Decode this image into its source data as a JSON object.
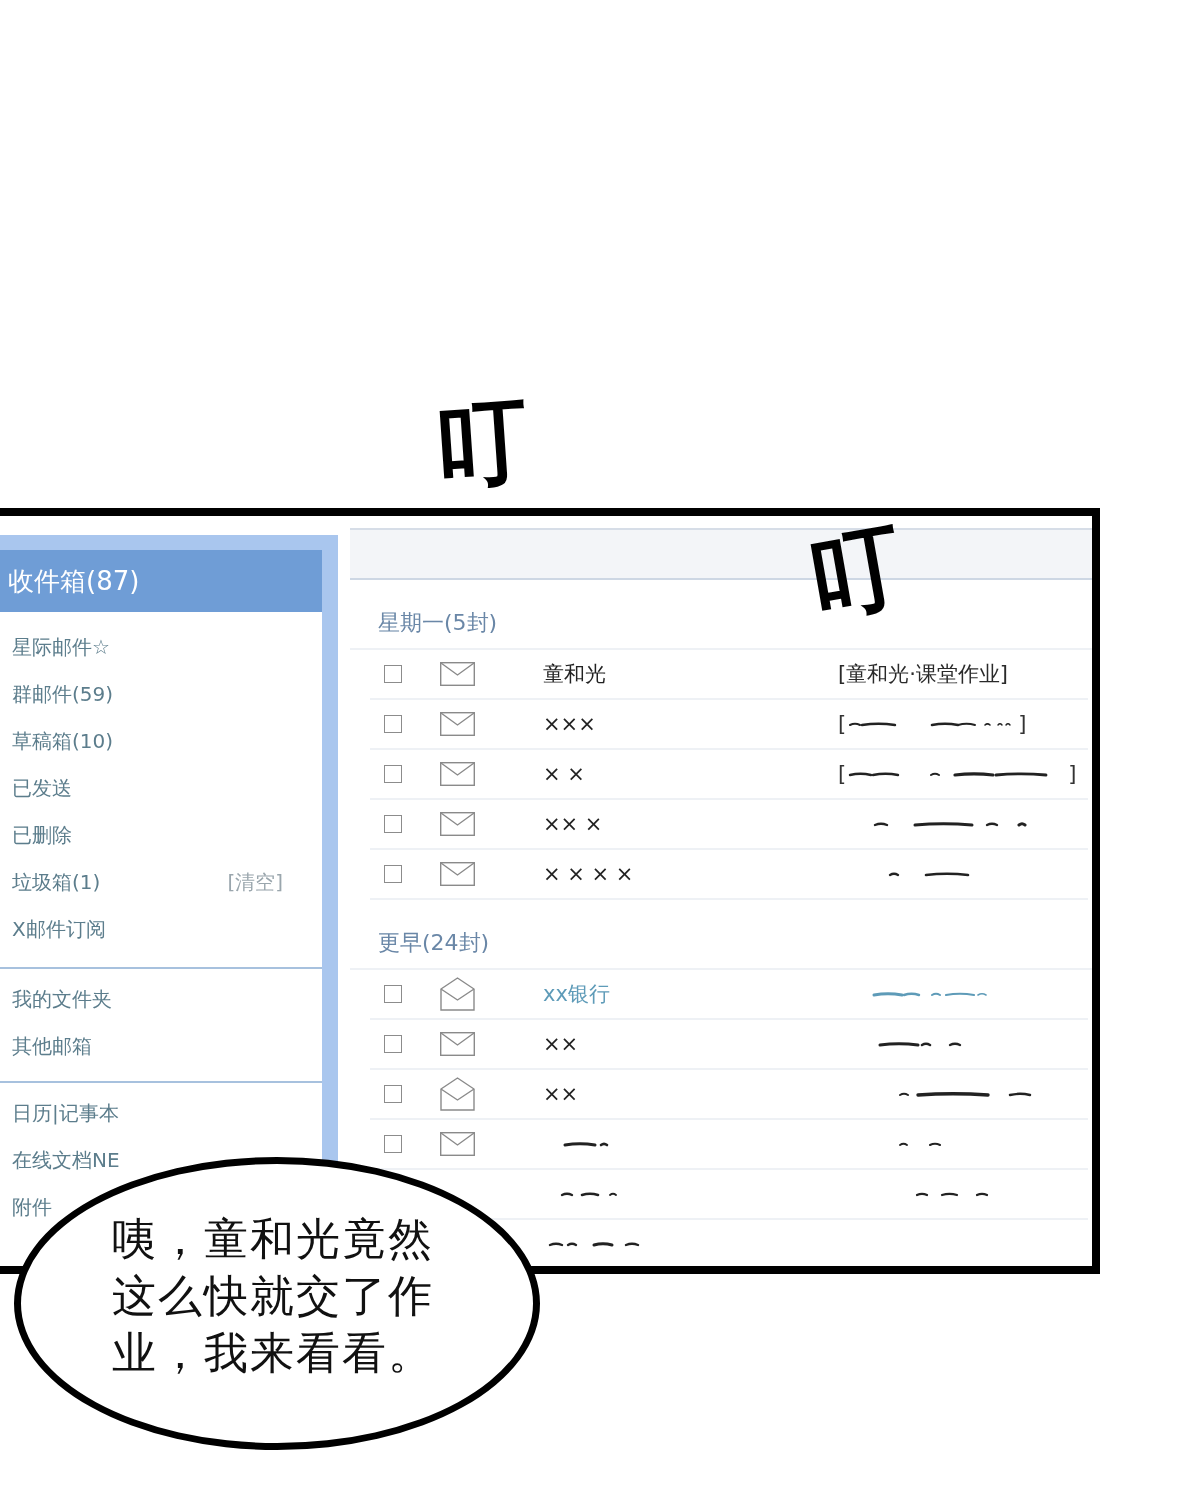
{
  "sound_effects": [
    {
      "text": "叮"
    },
    {
      "text": "叮"
    }
  ],
  "sidebar": {
    "header": "收件箱(87)",
    "sections": [
      {
        "items": [
          {
            "label": "星际邮件☆"
          },
          {
            "label": "群邮件(59)"
          },
          {
            "label": "草稿箱(10)"
          },
          {
            "label": "已发送"
          },
          {
            "label": "已删除"
          },
          {
            "label": "垃圾箱(1)",
            "action": "[清空]"
          },
          {
            "label": "X邮件订阅"
          }
        ]
      },
      {
        "items": [
          {
            "label": "我的文件夹"
          },
          {
            "label": "其他邮箱"
          }
        ]
      },
      {
        "items": [
          {
            "label": "日历|记事本"
          },
          {
            "label": "在线文档NE"
          },
          {
            "label": "附件"
          }
        ]
      }
    ]
  },
  "mail_list": {
    "groups": [
      {
        "title": "星期一(5封)",
        "rows": [
          {
            "kind": "full",
            "checked": false,
            "opened": false,
            "color": "#222222",
            "sender": {
              "kind": "text",
              "text": "童和光"
            },
            "subject": {
              "kind": "text",
              "text": "[童和光·课堂作业]"
            }
          },
          {
            "kind": "full",
            "checked": false,
            "opened": false,
            "color": "#222222",
            "sender": {
              "kind": "text",
              "text": "×××"
            },
            "subject": {
              "kind": "scribble",
              "open": "[",
              "close": "]"
            }
          },
          {
            "kind": "full",
            "checked": false,
            "opened": false,
            "color": "#222222",
            "sender": {
              "kind": "text",
              "text": "× ×"
            },
            "subject": {
              "kind": "scribble",
              "open": "[",
              "close": "]"
            }
          },
          {
            "kind": "full",
            "checked": false,
            "opened": false,
            "color": "#222222",
            "sender": {
              "kind": "text",
              "text": "×× ×"
            },
            "subject": {
              "kind": "scribble"
            }
          },
          {
            "kind": "full",
            "checked": false,
            "opened": false,
            "color": "#222222",
            "sender": {
              "kind": "text",
              "text": "× × × ×"
            },
            "subject": {
              "kind": "scribble"
            }
          }
        ]
      },
      {
        "title": "更早(24封)",
        "rows": [
          {
            "kind": "full",
            "checked": false,
            "opened": true,
            "color": "#5e9bb8",
            "sender": {
              "kind": "text",
              "text": "xx银行"
            },
            "subject": {
              "kind": "scribble"
            }
          },
          {
            "kind": "full",
            "checked": false,
            "opened": false,
            "color": "#222222",
            "sender": {
              "kind": "text",
              "text": "××"
            },
            "subject": {
              "kind": "scribble"
            }
          },
          {
            "kind": "full",
            "checked": false,
            "opened": true,
            "color": "#222222",
            "sender": {
              "kind": "text",
              "text": "××"
            },
            "subject": {
              "kind": "scribble"
            }
          },
          {
            "kind": "full",
            "checked": false,
            "opened": false,
            "color": "#222222",
            "sender": {
              "kind": "scribble"
            },
            "subject": {
              "kind": "scribble"
            }
          },
          {
            "kind": "covered",
            "color": "#222222",
            "sender": {
              "kind": "scribble"
            },
            "subject": {
              "kind": "scribble"
            }
          },
          {
            "kind": "covered",
            "color": "#222222",
            "sender": {
              "kind": "scribble"
            }
          }
        ]
      }
    ]
  },
  "speech_bubble": {
    "text": "咦，童和光竟然这么快就交了作业，我来看看。"
  }
}
